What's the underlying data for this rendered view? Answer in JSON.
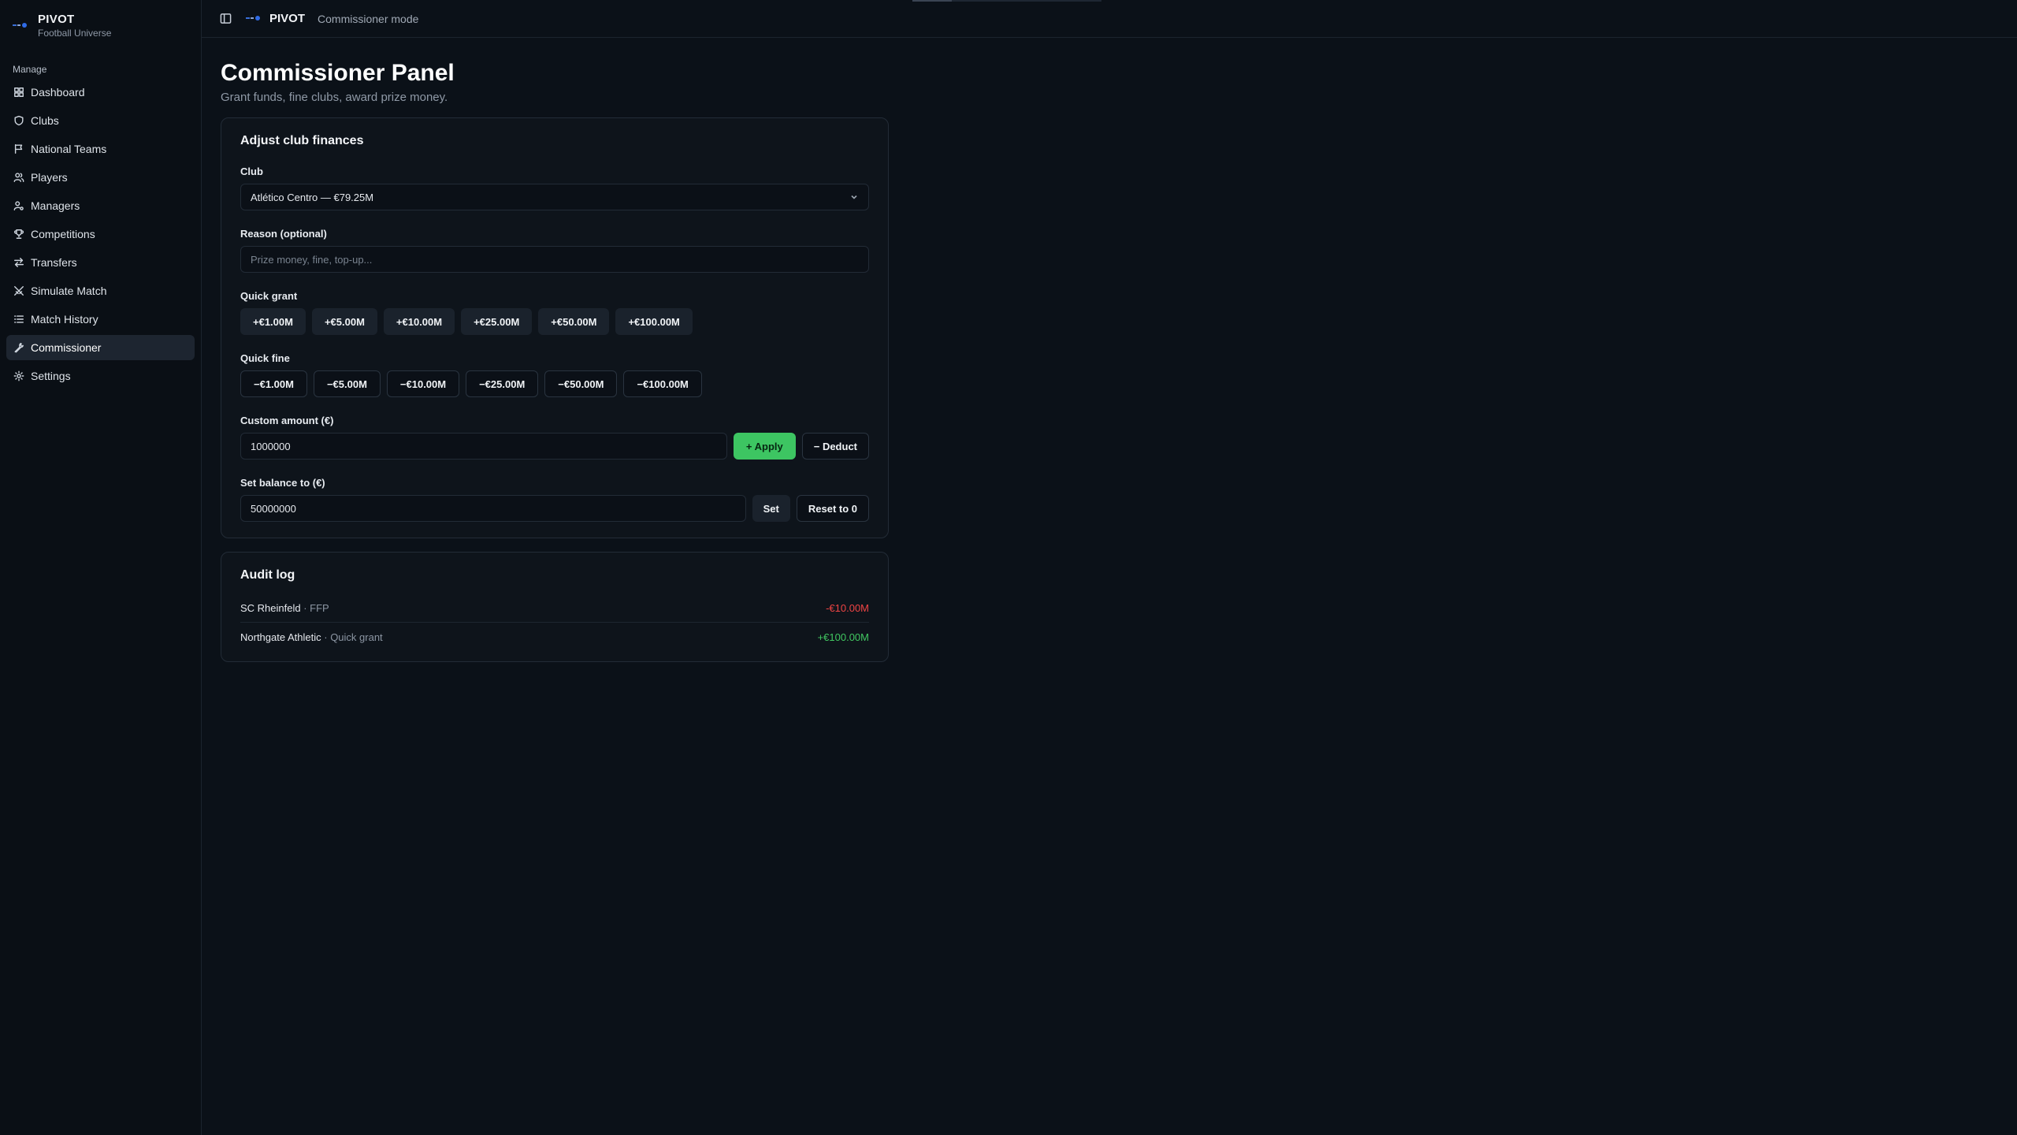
{
  "app": {
    "name": "PIVOT",
    "subtitle": "Football Universe"
  },
  "sidebar": {
    "section_label": "Manage",
    "items": [
      {
        "label": "Dashboard",
        "icon": "dashboard-icon"
      },
      {
        "label": "Clubs",
        "icon": "shield-icon"
      },
      {
        "label": "National Teams",
        "icon": "flag-icon"
      },
      {
        "label": "Players",
        "icon": "users-icon"
      },
      {
        "label": "Managers",
        "icon": "user-cog-icon"
      },
      {
        "label": "Competitions",
        "icon": "trophy-icon"
      },
      {
        "label": "Transfers",
        "icon": "transfer-icon"
      },
      {
        "label": "Simulate Match",
        "icon": "swords-icon"
      },
      {
        "label": "Match History",
        "icon": "list-icon"
      },
      {
        "label": "Commissioner",
        "icon": "wrench-icon",
        "active": true
      },
      {
        "label": "Settings",
        "icon": "gear-icon"
      }
    ]
  },
  "topbar": {
    "title": "PIVOT",
    "mode": "Commissioner mode"
  },
  "page": {
    "title": "Commissioner Panel",
    "subtitle": "Grant funds, fine clubs, award prize money."
  },
  "finances": {
    "card_title": "Adjust club finances",
    "club_label": "Club",
    "club_selected": "Atlético Centro — €79.25M",
    "reason_label": "Reason (optional)",
    "reason_placeholder": "Prize money, fine, top-up...",
    "quick_grant_label": "Quick grant",
    "quick_grant": [
      "+€1.00M",
      "+€5.00M",
      "+€10.00M",
      "+€25.00M",
      "+€50.00M",
      "+€100.00M"
    ],
    "quick_fine_label": "Quick fine",
    "quick_fine": [
      "−€1.00M",
      "−€5.00M",
      "−€10.00M",
      "−€25.00M",
      "−€50.00M",
      "−€100.00M"
    ],
    "custom_label": "Custom amount (€)",
    "custom_value": "1000000",
    "apply_label": "+ Apply",
    "deduct_label": "− Deduct",
    "balance_label": "Set balance to (€)",
    "balance_value": "50000000",
    "set_label": "Set",
    "reset_label": "Reset to 0"
  },
  "audit": {
    "card_title": "Audit log",
    "entries": [
      {
        "club": "SC Rheinfeld",
        "sep": " · ",
        "reason": "FFP",
        "amount": "-€10.00M",
        "type": "negative"
      },
      {
        "club": "Northgate Athletic",
        "sep": " · ",
        "reason": "Quick grant",
        "amount": "+€100.00M",
        "type": "positive"
      }
    ]
  },
  "colors": {
    "accent_green": "#3dc562",
    "negative_red": "#ef4444",
    "background": "#0b1118"
  }
}
